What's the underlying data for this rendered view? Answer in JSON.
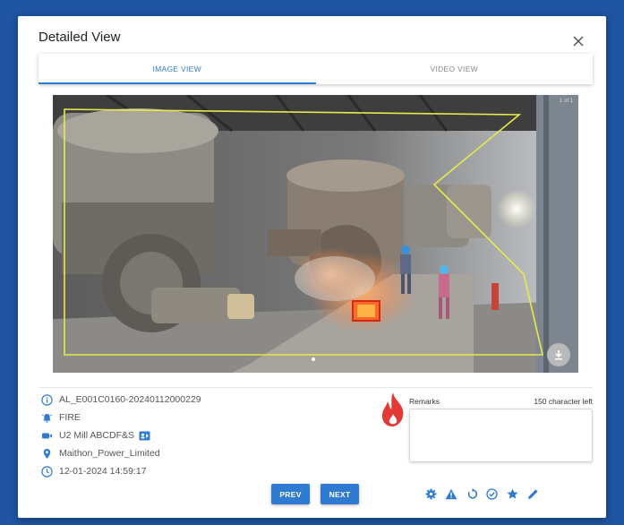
{
  "dialog": {
    "title": "Detailed View"
  },
  "tabs": [
    {
      "label": "IMAGE VIEW",
      "active": true
    },
    {
      "label": "VIDEO VIEW",
      "active": false
    }
  ],
  "viewer": {
    "page_count": "1 of 1"
  },
  "details": {
    "alert_id": "AL_E001C0160-20240112000229",
    "event_type": "FIRE",
    "camera": "U2 Mill ABCDF&S",
    "site": "Maithon_Power_Limited",
    "timestamp": "12-01-2024 14:59:17"
  },
  "remarks": {
    "label": "Remarks",
    "chars_left": "150 character left",
    "value": ""
  },
  "navigation": {
    "prev_label": "PREV",
    "next_label": "NEXT"
  },
  "actions": [
    {
      "icon": "gear-icon"
    },
    {
      "icon": "warning-icon"
    },
    {
      "icon": "refresh-icon"
    },
    {
      "icon": "check-circle-icon"
    },
    {
      "icon": "star-icon"
    },
    {
      "icon": "edit-icon"
    }
  ],
  "colors": {
    "background": "#1f55a3",
    "accent": "#2f7bd1",
    "detection_zone": "#e6ea4a",
    "fire_box": "#d42a10",
    "fire_icon": "#e53935"
  }
}
